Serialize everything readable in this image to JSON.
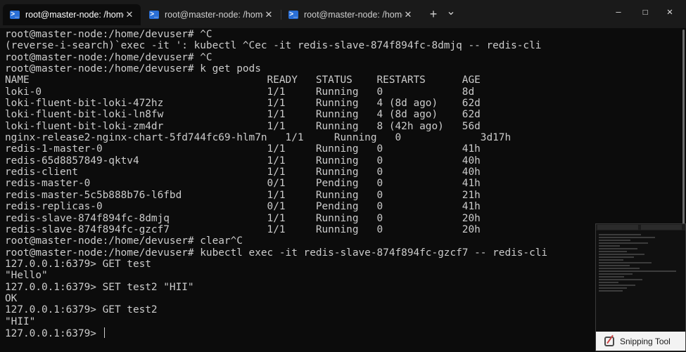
{
  "window": {
    "tabs": [
      {
        "title": "root@master-node: /home/de",
        "close": "✕",
        "active": true
      },
      {
        "title": "root@master-node: /home/de",
        "close": "✕",
        "active": false
      },
      {
        "title": "root@master-node: /home/de",
        "close": "✕",
        "active": false
      }
    ],
    "new_tab": "+",
    "dropdown": "⌄",
    "shell_icon": "powershell-icon",
    "controls": {
      "minimize": "—",
      "maximize": "☐",
      "close": "✕"
    }
  },
  "terminal": {
    "lines": [
      "root@master-node:/home/devuser# ^C",
      "(reverse-i-search)`exec -it ': kubectl ^Cec -it redis-slave-874f894fc-8dmjq -- redis-cli",
      "root@master-node:/home/devuser# ^C",
      "root@master-node:/home/devuser# k get pods",
      "NAME                                       READY   STATUS    RESTARTS      AGE",
      "loki-0                                     1/1     Running   0             8d",
      "loki-fluent-bit-loki-472hz                 1/1     Running   4 (8d ago)    62d",
      "loki-fluent-bit-loki-ln8fw                 1/1     Running   4 (8d ago)    62d",
      "loki-fluent-bit-loki-zm4dr                 1/1     Running   8 (42h ago)   56d",
      "nginx-release2-nginx-chart-5fd744fc69-hlm7n   1/1     Running   0             3d17h",
      "redis-1-master-0                           1/1     Running   0             41h",
      "redis-65d8857849-qktv4                     1/1     Running   0             40h",
      "redis-client                               1/1     Running   0             40h",
      "redis-master-0                             0/1     Pending   0             41h",
      "redis-master-5c5b888b76-l6fbd              1/1     Running   0             21h",
      "redis-replicas-0                           0/1     Pending   0             41h",
      "redis-slave-874f894fc-8dmjq                1/1     Running   0             20h",
      "redis-slave-874f894fc-gzcf7                1/1     Running   0             20h",
      "root@master-node:/home/devuser# clear^C",
      "root@master-node:/home/devuser# kubectl exec -it redis-slave-874f894fc-gzcf7 -- redis-cli",
      "127.0.0.1:6379> GET test",
      "\"Hello\"",
      "127.0.0.1:6379> SET test2 \"HII\"",
      "OK",
      "127.0.0.1:6379> GET test2",
      "\"HII\"",
      "127.0.0.1:6379> "
    ]
  },
  "snipping_tool": {
    "label": "Snipping Tool",
    "icon": "snipping-tool-icon"
  },
  "colors": {
    "background": "#0c0c0c",
    "text": "#cccccc",
    "titlebar": "#1a1a1a",
    "accent": "#2a6fd6"
  }
}
